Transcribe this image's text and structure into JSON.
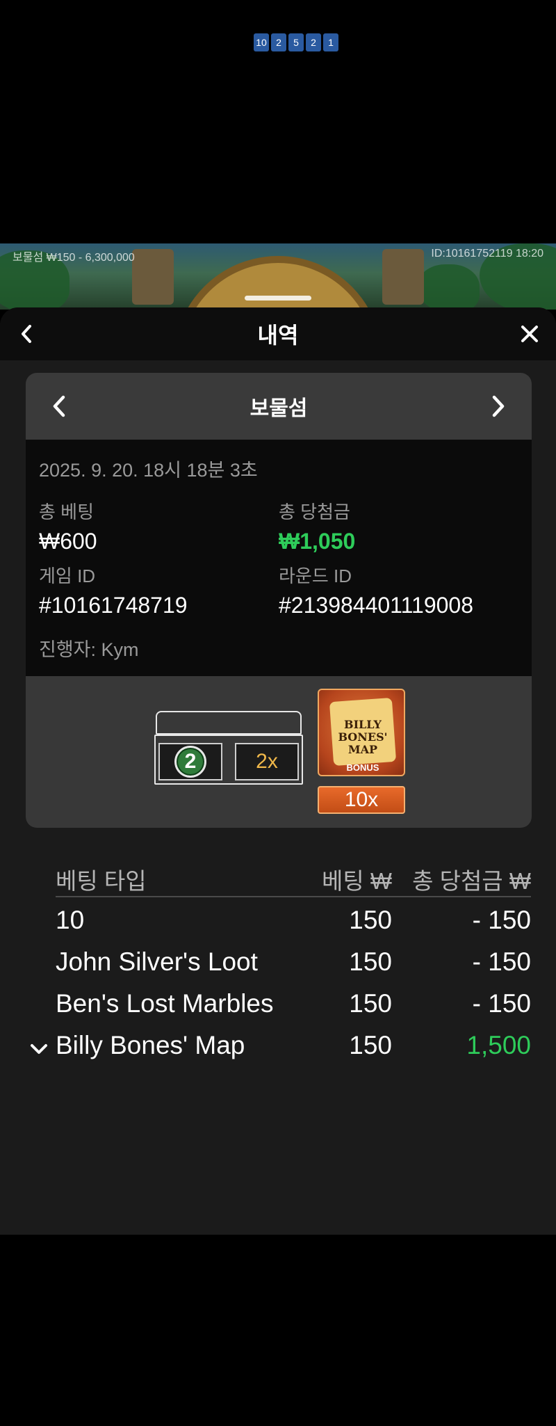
{
  "game_strip": {
    "limits_text": "보물섬 ₩150 - 6,300,000",
    "round_info": "ID:10161752119 18:20",
    "wheel_numbers": [
      "10",
      "2",
      "5",
      "2",
      "1"
    ]
  },
  "header": {
    "title": "내역"
  },
  "card": {
    "game_name": "보물섬",
    "datetime": "2025. 9. 20. 18시 18분 3초",
    "total_bet_label": "총 베팅",
    "total_bet_value": "₩600",
    "total_win_label": "총 당첨금",
    "total_win_value": "₩1,050",
    "game_id_label": "게임 ID",
    "game_id_value": "#10161748719",
    "round_id_label": "라운드 ID",
    "round_id_value": "#213984401119008",
    "dealer": "진행자: Kym",
    "result": {
      "chest_number": "2",
      "chest_multiplier": "2x",
      "bonus_title_line1": "BILLY",
      "bonus_title_line2": "BONES'",
      "bonus_title_line3": "MAP",
      "bonus_label": "BONUS",
      "bonus_multiplier": "10x"
    }
  },
  "bets": {
    "columns": {
      "type": "베팅 타입",
      "bet": "베팅 ₩",
      "win": "총 당첨금 ₩"
    },
    "rows": [
      {
        "type": "10",
        "bet": "150",
        "win": "- 150",
        "expandable": false
      },
      {
        "type": "John Silver's Loot",
        "bet": "150",
        "win": "- 150",
        "expandable": false
      },
      {
        "type": "Ben's Lost Marbles",
        "bet": "150",
        "win": "- 150",
        "expandable": false
      },
      {
        "type": "Billy Bones' Map",
        "bet": "150",
        "win": "1,500",
        "expandable": true
      }
    ]
  },
  "colors": {
    "win_green": "#2ecc5a",
    "sheet_bg": "#1b1b1b",
    "card_header_bg": "#3a3a3a"
  }
}
